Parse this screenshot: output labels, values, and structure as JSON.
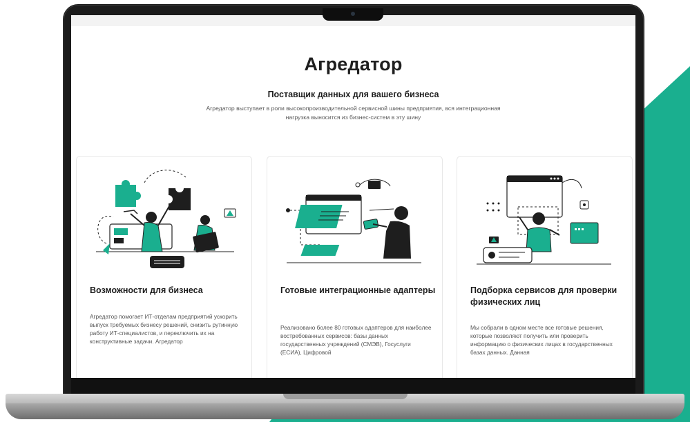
{
  "page": {
    "title": "Агредатор",
    "subtitle": "Поставщик данных для вашего бизнеса",
    "description": "Агредатор выступает в роли высокопроизводительной сервисной шины предприятия, вся интеграционная нагрузка выносится из бизнес-систем в эту шину"
  },
  "cards": [
    {
      "title": "Возможности для бизнеса",
      "text": "Агредатор помогает ИТ-отделам предприятий ускорить выпуск требуемых бизнесу решений, снизить рутинную работу ИТ-специалистов, и переключить их на конструктивные задачи. Агредатор",
      "illustration": "puzzle-team-illustration"
    },
    {
      "title": "Готовые интеграционные адаптеры",
      "text": "Реализовано более 80 готовых адаптеров для наиболее востребованных сервисов: базы данных государственных учреждений (СМЭВ), Госуслуги (ЕСИА), Цифровой",
      "illustration": "adapters-illustration"
    },
    {
      "title": "Подборка сервисов для проверки физических лиц",
      "text": "Мы собрали в одном месте все готовые решения, которые позволяют получить или проверить информацию о физических лицах в государственных базах данных. Данная",
      "illustration": "person-check-illustration"
    }
  ],
  "colors": {
    "accent": "#1aaf8f",
    "dark": "#1e1e1e",
    "background": "#ffffff"
  }
}
